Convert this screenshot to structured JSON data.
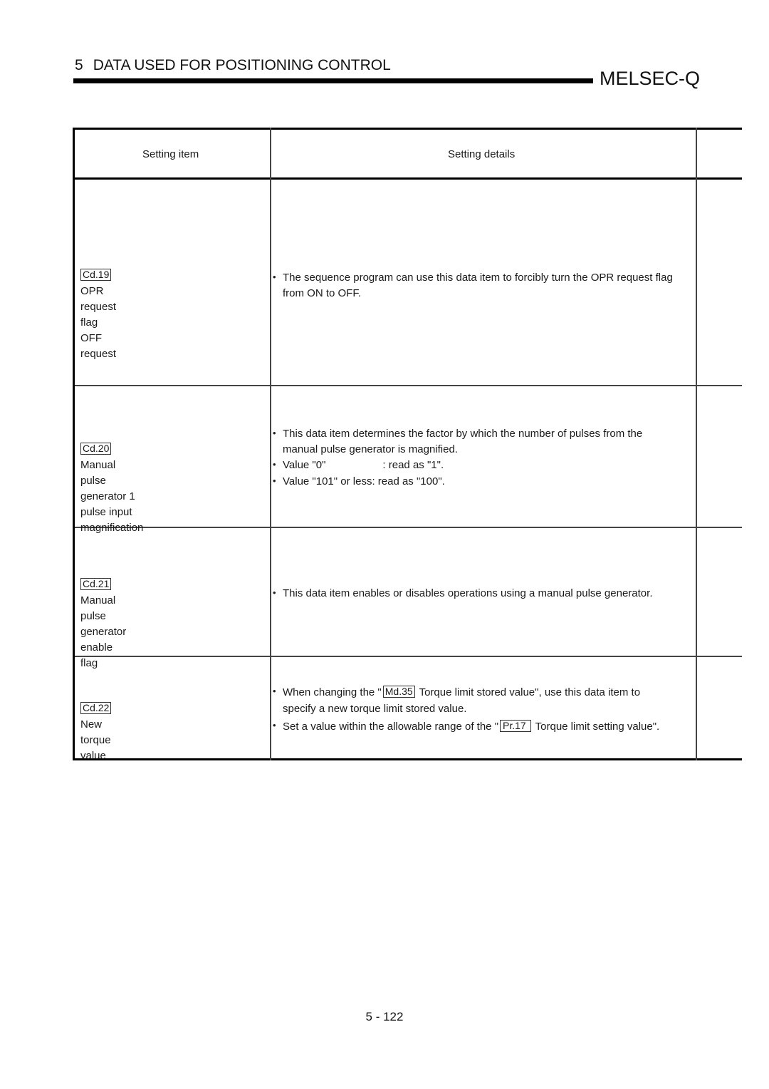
{
  "header": {
    "chapter_number": "5",
    "chapter_title": "DATA USED FOR POSITIONING CONTROL",
    "brand": "MELSEC-Q"
  },
  "table": {
    "columns": [
      "Setting item",
      "Setting details",
      ""
    ],
    "rows": [
      {
        "code": "Cd.19",
        "name_lines": [
          "OPR request flag OFF",
          "request"
        ],
        "details": [
          {
            "text": "The sequence program can use this data item to forcibly turn the OPR request flag from ON to OFF."
          }
        ]
      },
      {
        "code": "Cd.20",
        "name_lines": [
          "Manual pulse generator 1",
          "pulse input magnification"
        ],
        "details": [
          {
            "text": "This data item determines the factor by which the number of pulses from the manual pulse generator is magnified."
          },
          {
            "text_a": "Value \"0\"",
            "text_b": ": read as \"1\"."
          },
          {
            "text": "Value \"101\" or less: read as \"100\"."
          }
        ]
      },
      {
        "code": "Cd.21",
        "name_lines": [
          "Manual pulse generator",
          "enable flag"
        ],
        "details": [
          {
            "text": "This data item enables or disables operations using a manual pulse generator."
          }
        ]
      },
      {
        "code": "Cd.22",
        "name_lines": [
          "New torque value"
        ],
        "details": [
          {
            "pre": "When changing the \"",
            "ref": "Md.35",
            "post": "Torque limit stored value\", use this data item to specify a new torque limit stored value."
          },
          {
            "pre": "Set a value within the allowable range of the \"",
            "ref": "Pr.17",
            "post": "Torque limit setting value\"."
          }
        ]
      }
    ]
  },
  "footer": {
    "page_number": "5 - 122"
  }
}
